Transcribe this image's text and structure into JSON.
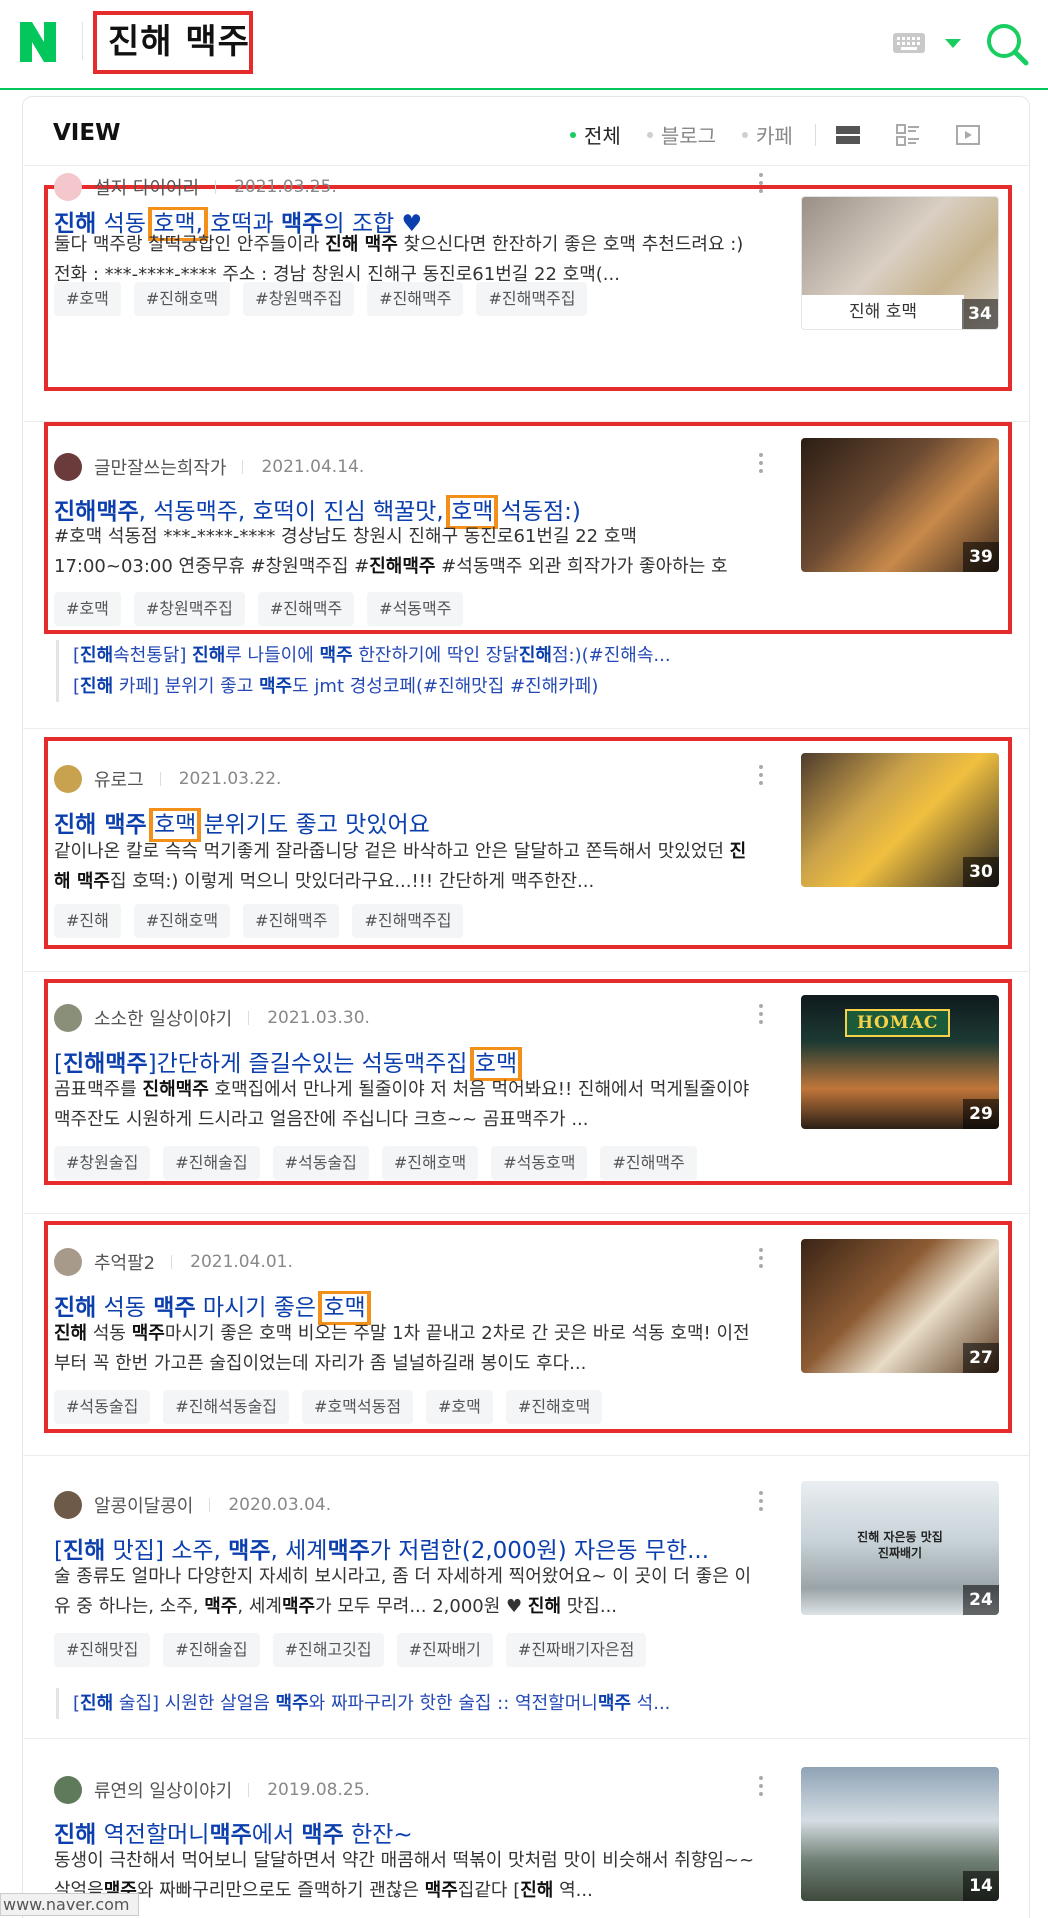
{
  "header": {
    "query": "진해 맥주",
    "logo": "N"
  },
  "view": {
    "title": "VIEW",
    "filters": [
      {
        "label": "전체",
        "active": true
      },
      {
        "label": "블로그",
        "active": false
      },
      {
        "label": "카페",
        "active": false
      }
    ]
  },
  "items": [
    {
      "author": "설지 다이어리",
      "date": "2021.03.25.",
      "title": [
        [
          "진해",
          "b"
        ],
        [
          " 석동 ",
          ""
        ],
        [
          "호맥,",
          "hl"
        ],
        [
          " 호떡과 ",
          ""
        ],
        [
          "맥주",
          "b"
        ],
        [
          "의 조합 ♥",
          ""
        ]
      ],
      "desc": [
        [
          "둘다 맥주랑 찰떡궁합인 안주들이라 ",
          ""
        ],
        [
          "진해 맥주",
          "b"
        ],
        [
          " 찾으신다면 한잔하기 좋은 호맥 추천드려요 :) 전화 : ***-****-**** 주소 : 경남 창원시 진해구 동진로61번길 22 호맥(...",
          ""
        ]
      ],
      "tags": [
        "#호맥",
        "#진해호맥",
        "#창원맥주집",
        "#진해맥주",
        "#진해맥주집"
      ],
      "thumb_count": "34",
      "thumb_caption": "진해 호맥"
    },
    {
      "author": "글만잘쓰는희작가",
      "date": "2021.04.14.",
      "title": [
        [
          "진해맥주",
          "b"
        ],
        [
          ", 석동맥주, 호떡이 진심 핵꿀맛, ",
          ""
        ],
        [
          "호맥",
          "hl"
        ],
        [
          " 석동점:)",
          ""
        ]
      ],
      "desc": [
        [
          "#호맥 석동점 ***-****-**** 경상남도 창원시 진해구 동진로61번길 22 호맥 17:00~03:00 연중무휴 #창원맥주집 #",
          ""
        ],
        [
          "진해맥주",
          "b"
        ],
        [
          " #석동맥주 외관 희작가가 좋아하는 호맥!!...",
          ""
        ]
      ],
      "tags": [
        "#호맥",
        "#창원맥주집",
        "#진해맥주",
        "#석동맥주"
      ],
      "thumb_count": "39",
      "subs": [
        [
          [
            "[",
            ""
          ],
          [
            "진해",
            "b"
          ],
          [
            "속천통닭] ",
            ""
          ],
          [
            "진해",
            "b"
          ],
          [
            "루 나들이에 ",
            ""
          ],
          [
            "맥주",
            "b"
          ],
          [
            " 한잔하기에 딱인 장닭",
            ""
          ],
          [
            "진해",
            "b"
          ],
          [
            "점:)(#진해속...",
            ""
          ]
        ],
        [
          [
            "[",
            ""
          ],
          [
            "진해",
            "b"
          ],
          [
            " 카페] 분위기 좋고 ",
            ""
          ],
          [
            "맥주",
            "b"
          ],
          [
            "도 jmt 경성코페(#진해맛집 #진해카페)",
            ""
          ]
        ]
      ]
    },
    {
      "author": "유로그",
      "date": "2021.03.22.",
      "title": [
        [
          "진해 맥주",
          "b"
        ],
        [
          " ",
          ""
        ],
        [
          "호맥",
          "hl"
        ],
        [
          " 분위기도 좋고 맛있어요",
          ""
        ]
      ],
      "desc": [
        [
          "같이나온 칼로 슥슥 먹기좋게 잘라줍니당 겉은 바삭하고 안은 달달하고 쫀득해서 맛있었던 ",
          ""
        ],
        [
          "진해 맥주",
          "b"
        ],
        [
          "집 호떡:) 이렇게 먹으니 맛있더라구요...!!! 간단하게 맥주한잔...",
          ""
        ]
      ],
      "tags": [
        "#진해",
        "#진해호맥",
        "#진해맥주",
        "#진해맥주집"
      ],
      "thumb_count": "30"
    },
    {
      "author": "소소한 일상이야기",
      "date": "2021.03.30.",
      "title": [
        [
          "[",
          ""
        ],
        [
          "진해맥주",
          "b"
        ],
        [
          "]간단하게 즐길수있는 석동맥주집 ",
          ""
        ],
        [
          "호맥",
          "hl"
        ]
      ],
      "desc": [
        [
          "곰표맥주를 ",
          ""
        ],
        [
          "진해맥주",
          "b"
        ],
        [
          " 호맥집에서 만나게 될줄이야 저 처음 먹어봐요!! 진해에서 먹게될줄이야 맥주잔도 시원하게 드시라고 얼음잔에 주십니다 크흐~~ 곰표맥주가 ...",
          ""
        ]
      ],
      "tags": [
        "#창원술집",
        "#진해술집",
        "#석동술집",
        "#진해호맥",
        "#석동호맥",
        "#진해맥주"
      ],
      "thumb_count": "29",
      "thumb_sign": "HOMAC"
    },
    {
      "author": "추억팔2",
      "date": "2021.04.01.",
      "title": [
        [
          "진해",
          "b"
        ],
        [
          " 석동 ",
          ""
        ],
        [
          "맥주",
          "b"
        ],
        [
          " 마시기 좋은 ",
          ""
        ],
        [
          "호맥",
          "hl"
        ]
      ],
      "desc": [
        [
          "진해",
          "b"
        ],
        [
          " 석동 ",
          ""
        ],
        [
          "맥주",
          "b"
        ],
        [
          "마시기 좋은 호맥 비오는 주말 1차 끝내고 2차로 간 곳은 바로 석동 호맥! 이전부터 꼭 한번 가고픈 술집이었는데 자리가 좀 널널하길래 봉이도 후다...",
          ""
        ]
      ],
      "tags": [
        "#석동술집",
        "#진해석동술집",
        "#호맥석동점",
        "#호맥",
        "#진해호맥"
      ],
      "thumb_count": "27"
    },
    {
      "author": "알콩이달콩이",
      "date": "2020.03.04.",
      "title": [
        [
          "[",
          ""
        ],
        [
          "진해",
          "b"
        ],
        [
          " 맛집] 소주, ",
          ""
        ],
        [
          "맥주",
          "b"
        ],
        [
          ", 세계",
          ""
        ],
        [
          "맥주",
          "b"
        ],
        [
          "가 저렴한(2,000원) 자은동 무한...",
          ""
        ]
      ],
      "desc": [
        [
          "술 종류도 얼마나 다양한지 자세히 보시라고, 좀 더 자세하게 찍어왔어요~ 이 곳이 더 좋은 이유 중 하나는, 소주, ",
          ""
        ],
        [
          "맥주",
          "b"
        ],
        [
          ", 세계",
          ""
        ],
        [
          "맥주",
          "b"
        ],
        [
          "가 모두 무려... 2,000원 ♥ ",
          ""
        ],
        [
          "진해",
          "b"
        ],
        [
          " 맛집...",
          ""
        ]
      ],
      "tags": [
        "#진해맛집",
        "#진해술집",
        "#진해고깃집",
        "#진짜배기",
        "#진짜배기자은점"
      ],
      "thumb_count": "24",
      "thumb_text": [
        "진해 자은동 맛집",
        "진짜배기"
      ],
      "subs": [
        [
          [
            "[",
            ""
          ],
          [
            "진해",
            "b"
          ],
          [
            " 술집] 시원한 살얼음 ",
            ""
          ],
          [
            "맥주",
            "b"
          ],
          [
            "와 짜파구리가 핫한 술집 :: 역전할머니",
            ""
          ],
          [
            "맥주",
            "b"
          ],
          [
            " 석...",
            ""
          ]
        ]
      ]
    },
    {
      "author": "류연의 일상이야기",
      "date": "2019.08.25.",
      "title": [
        [
          "진해",
          "b"
        ],
        [
          " 역전할머니",
          ""
        ],
        [
          "맥주",
          "b"
        ],
        [
          "에서 ",
          ""
        ],
        [
          "맥주",
          "b"
        ],
        [
          " 한잔~",
          ""
        ]
      ],
      "desc": [
        [
          "동생이 극찬해서 먹어보니 달달하면서 약간 매콤해서 떡볶이 맛처럼 맛이 비슷해서 취향임~~ 살얼음",
          ""
        ],
        [
          "맥주",
          "b"
        ],
        [
          "와 짜빠구리만으로도 즐맥하기 괜찮은 ",
          ""
        ],
        [
          "맥주",
          "b"
        ],
        [
          "집같다 [",
          ""
        ],
        [
          "진해",
          "b"
        ],
        [
          " 역...",
          ""
        ]
      ],
      "tags": [],
      "thumb_count": "14"
    }
  ],
  "footer": {
    "url": "www.naver.com"
  },
  "colors": {
    "naver_green": "#03c75a",
    "link_blue": "#0c3fae",
    "annot_red": "#e52b2b",
    "annot_orange": "#f29019"
  },
  "icons": [
    "naver-logo-icon",
    "keyboard-icon",
    "chevron-down-icon",
    "search-icon",
    "list-view-icon",
    "grid-view-icon",
    "video-view-icon",
    "more-icon"
  ]
}
